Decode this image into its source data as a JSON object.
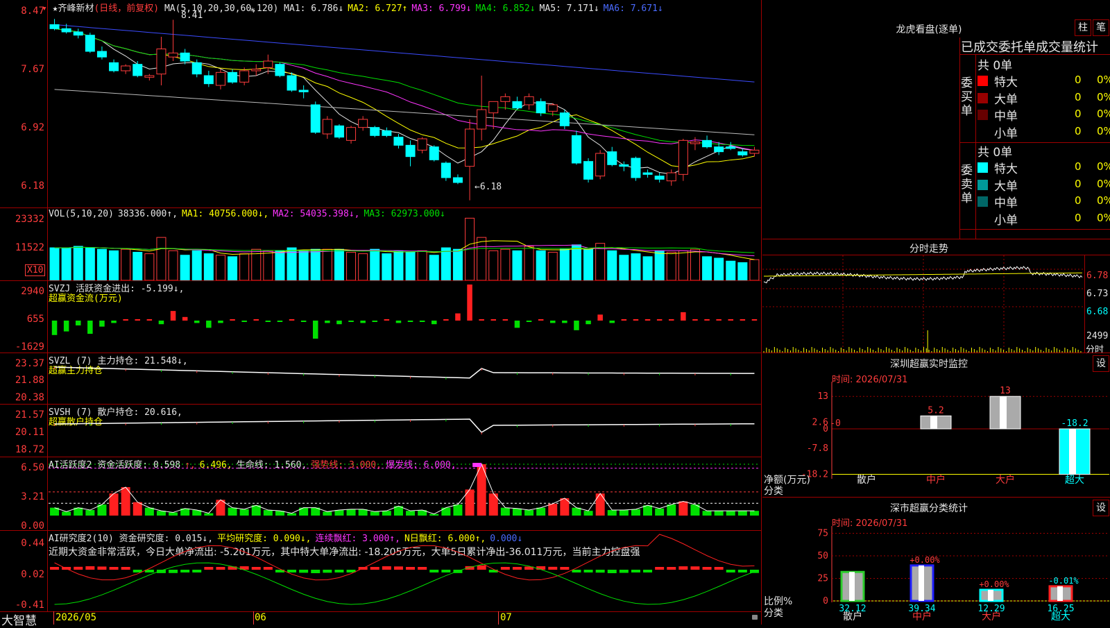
{
  "stock": {
    "marker": "▾",
    "name": "★齐峰新材",
    "period": "(日线，前复权)"
  },
  "ma_line": {
    "prefix": "MA(5,10,20,30,60,120)",
    "items": [
      {
        "label": "MA1: 6.786",
        "arrow": "↓",
        "color": "#e6e6e6"
      },
      {
        "label": "MA2: 6.727",
        "arrow": "↑",
        "color": "#ffff00"
      },
      {
        "label": "MA3: 6.799",
        "arrow": "↓",
        "color": "#ff35ff"
      },
      {
        "label": "MA4: 6.852",
        "arrow": "↓",
        "color": "#00e000"
      },
      {
        "label": "MA5: 7.171",
        "arrow": "↓",
        "color": "#e6e6e6"
      },
      {
        "label": "MA6: 7.671",
        "arrow": "↓",
        "color": "#4a6bff"
      }
    ]
  },
  "price_axis": [
    "8.47",
    "7.67",
    "6.92",
    "6.18"
  ],
  "price_annotations": {
    "high": "8.41",
    "low": "←6.18"
  },
  "vol": {
    "axis": [
      "23332",
      "11522"
    ],
    "unit": "X10",
    "legend": [
      {
        "text": "VOL(5,10,20)",
        "color": "#e6e6e6"
      },
      {
        "text": "38336.000↑,",
        "color": "#e6e6e6"
      },
      {
        "text": "MA1: 40756.000↓,",
        "color": "#ffff00"
      },
      {
        "text": "MA2: 54035.398↓,",
        "color": "#ff35ff"
      },
      {
        "text": "MA3: 62973.000↓",
        "color": "#00e000"
      }
    ]
  },
  "svzj": {
    "axis": [
      "2940",
      "655",
      "-1629"
    ],
    "line1": "SVZJ  活跃资金进出: -5.199↓,",
    "line2": "超赢资金流(万元)"
  },
  "svzl": {
    "axis": [
      "23.37",
      "21.88",
      "20.38"
    ],
    "line1": "SVZL (7) 主力持仓: 21.548↓,",
    "line2": "超赢主力持仓"
  },
  "svsh": {
    "axis": [
      "21.57",
      "20.11",
      "18.72"
    ],
    "line1": "SVSH (7) 散户持仓: 20.616,",
    "line2": "超赢散户持仓"
  },
  "ai_active": {
    "axis": [
      "6.50",
      "3.21",
      "0.00"
    ],
    "legend": [
      {
        "text": "AI活跃度2 资金活跃度: 0.598",
        "color": "#e6e6e6"
      },
      {
        "text": "↑,",
        "color": "#ff3c3c"
      },
      {
        "text": "6.496,",
        "color": "#ffff00"
      },
      {
        "text": "生命线: 1.560,",
        "color": "#e6e6e6"
      },
      {
        "text": "强势线: 3.000,",
        "color": "#ff3c3c"
      },
      {
        "text": "爆发线: 6.000,",
        "color": "#ff35ff"
      }
    ]
  },
  "ai_research": {
    "axis": [
      "0.44",
      "0.02",
      "-0.41"
    ],
    "legend": [
      {
        "text": "AI研究度2(10) 资金研究度: 0.015↓,",
        "color": "#e6e6e6"
      },
      {
        "text": "平均研究度: 0.090↓,",
        "color": "#ffff00"
      },
      {
        "text": "连续飘红: 3.000↑,",
        "color": "#ff35ff"
      },
      {
        "text": "N日飘红: 6.000↑,",
        "color": "#ffff00"
      },
      {
        "text": "0.000↓",
        "color": "#4a6bff"
      }
    ],
    "comment": "近期大资金非常活跃，今日大单净流出: -5.201万元，其中特大单净流出: -18.205万元，大单5日累计净出-36.011万元，当前主力控盘强"
  },
  "bottom_bar": {
    "brand": "大智慧",
    "dates": [
      "2026/05",
      "06",
      "07"
    ]
  },
  "dragon_tiger": {
    "title": "龙虎看盘(逐单)",
    "btn_bar": "柱",
    "btn_pen": "笔",
    "tabs": "已成交委托单成交量统计",
    "buy": {
      "side": "委买单",
      "total": "共 0单",
      "rows": [
        {
          "name": "特大",
          "count": "0",
          "pct": "0%",
          "color": "#ff0000"
        },
        {
          "name": "大单",
          "count": "0",
          "pct": "0%",
          "color": "#990000"
        },
        {
          "name": "中单",
          "count": "0",
          "pct": "0%",
          "color": "#660000"
        },
        {
          "name": "小单",
          "count": "0",
          "pct": "0%",
          "color": "#000000"
        }
      ]
    },
    "sell": {
      "side": "委卖单",
      "total": "共 0单",
      "rows": [
        {
          "name": "特大",
          "count": "0",
          "pct": "0%",
          "color": "#00ffff"
        },
        {
          "name": "大单",
          "count": "0",
          "pct": "0%",
          "color": "#009999"
        },
        {
          "name": "中单",
          "count": "0",
          "pct": "0%",
          "color": "#006666"
        },
        {
          "name": "小单",
          "count": "0",
          "pct": "0%",
          "color": "#000000"
        }
      ]
    }
  },
  "intraday": {
    "title": "分时走势",
    "axis": [
      "6.78",
      "6.73",
      "6.68"
    ],
    "vol_label": "2499",
    "vol_unit": "分时"
  },
  "realtime_monitor": {
    "title": "深圳超赢实时监控",
    "btn": "设",
    "time": "时间: 2026/07/31",
    "axis": [
      "13",
      "2.6",
      "0",
      "-7.8",
      "-18.2"
    ],
    "ylabel": "净额(万元)",
    "xlabel": "分类",
    "categories": [
      "散户",
      "中户",
      "大户",
      "超大"
    ],
    "values": [
      0,
      5.2,
      13,
      -18.2
    ],
    "labels": [
      "-0",
      "5.2",
      "13",
      "-18.2"
    ]
  },
  "class_stats": {
    "title": "深市超赢分类统计",
    "btn": "设",
    "time": "时间: 2026/07/31",
    "axis": [
      "75",
      "50",
      "25",
      "0"
    ],
    "ylabel": "比例%",
    "xlabel": "分类",
    "categories": [
      "散户",
      "中户",
      "大户",
      "超大"
    ],
    "values": [
      32.12,
      39.34,
      12.29,
      16.25
    ],
    "changes": [
      "",
      "+0.00%",
      "+0.00%",
      "-0.01%"
    ]
  },
  "chart_data": [
    {
      "type": "candlestick",
      "title": "齐峰新材 (日线，前复权)",
      "x": [
        "2026/05",
        "06",
        "07"
      ],
      "ylim": [
        6.18,
        8.47
      ],
      "ohlc": [
        [
          8.35,
          8.42,
          8.28,
          8.3
        ],
        [
          8.3,
          8.36,
          8.24,
          8.26
        ],
        [
          8.26,
          8.3,
          8.18,
          8.22
        ],
        [
          8.22,
          8.25,
          8.0,
          8.02
        ],
        [
          8.02,
          8.08,
          7.92,
          7.95
        ],
        [
          7.88,
          7.92,
          7.76,
          7.78
        ],
        [
          7.78,
          7.86,
          7.74,
          7.84
        ],
        [
          7.86,
          7.9,
          7.7,
          7.72
        ],
        [
          7.7,
          7.74,
          7.66,
          7.72
        ],
        [
          7.74,
          8.2,
          7.6,
          8.05
        ],
        [
          7.95,
          8.41,
          7.9,
          8.0
        ],
        [
          8.0,
          8.05,
          7.86,
          7.9
        ],
        [
          7.88,
          7.92,
          7.7,
          7.74
        ],
        [
          7.72,
          7.78,
          7.58,
          7.62
        ],
        [
          7.6,
          7.8,
          7.55,
          7.76
        ],
        [
          7.76,
          7.8,
          7.62,
          7.64
        ],
        [
          7.64,
          7.82,
          7.6,
          7.78
        ],
        [
          7.78,
          7.86,
          7.72,
          7.8
        ],
        [
          7.82,
          7.98,
          7.74,
          7.9
        ],
        [
          7.86,
          7.88,
          7.7,
          7.72
        ],
        [
          7.72,
          7.76,
          7.52,
          7.54
        ],
        [
          7.54,
          7.6,
          7.44,
          7.52
        ],
        [
          7.36,
          7.4,
          7.0,
          7.02
        ],
        [
          7.0,
          7.22,
          6.94,
          7.18
        ],
        [
          7.1,
          7.12,
          6.94,
          6.96
        ],
        [
          6.92,
          7.1,
          6.88,
          7.08
        ],
        [
          7.08,
          7.22,
          7.04,
          7.18
        ],
        [
          7.08,
          7.1,
          6.96,
          6.98
        ],
        [
          7.04,
          7.08,
          6.96,
          6.98
        ],
        [
          6.96,
          7.0,
          6.82,
          6.86
        ],
        [
          6.86,
          6.92,
          6.6,
          6.72
        ],
        [
          6.8,
          6.96,
          6.76,
          6.94
        ],
        [
          6.84,
          6.86,
          6.66,
          6.68
        ],
        [
          6.64,
          6.66,
          6.42,
          6.46
        ],
        [
          6.46,
          6.5,
          6.38,
          6.4
        ],
        [
          6.6,
          7.18,
          6.18,
          7.06
        ],
        [
          7.06,
          7.72,
          6.92,
          7.3
        ],
        [
          7.26,
          7.4,
          7.06,
          7.4
        ],
        [
          7.4,
          7.5,
          7.3,
          7.46
        ],
        [
          7.4,
          7.46,
          7.3,
          7.32
        ],
        [
          7.36,
          7.5,
          7.3,
          7.46
        ],
        [
          7.4,
          7.44,
          7.22,
          7.26
        ],
        [
          7.28,
          7.38,
          7.22,
          7.36
        ],
        [
          7.26,
          7.3,
          7.06,
          7.1
        ],
        [
          6.98,
          7.04,
          6.62,
          6.64
        ],
        [
          6.66,
          6.7,
          6.4,
          6.44
        ],
        [
          6.48,
          6.8,
          6.44,
          6.76
        ],
        [
          6.78,
          6.84,
          6.6,
          6.62
        ],
        [
          6.62,
          6.66,
          6.54,
          6.6
        ],
        [
          6.7,
          6.72,
          6.42,
          6.46
        ],
        [
          6.52,
          6.56,
          6.46,
          6.5
        ],
        [
          6.48,
          6.52,
          6.4,
          6.44
        ],
        [
          6.42,
          6.56,
          6.36,
          6.52
        ],
        [
          6.5,
          6.94,
          6.42,
          6.92
        ],
        [
          6.88,
          6.96,
          6.8,
          6.9
        ],
        [
          6.92,
          6.98,
          6.82,
          6.84
        ],
        [
          6.84,
          6.9,
          6.74,
          6.78
        ],
        [
          6.84,
          6.9,
          6.8,
          6.82
        ],
        [
          6.78,
          6.82,
          6.72,
          6.74
        ],
        [
          6.76,
          6.84,
          6.72,
          6.8
        ]
      ]
    },
    {
      "type": "bar",
      "title": "VOL",
      "values": [
        22,
        22,
        23,
        22,
        21,
        20,
        21,
        19,
        18,
        29,
        20,
        17,
        20,
        18,
        17,
        16,
        18,
        21,
        20,
        20,
        22,
        20,
        21,
        21,
        21,
        19,
        18,
        21,
        18,
        20,
        19,
        20,
        17,
        22,
        21,
        42,
        29,
        20,
        21,
        20,
        23,
        20,
        19,
        21,
        24,
        21,
        25,
        20,
        17,
        18,
        16,
        20,
        19,
        20,
        21,
        16,
        15,
        13,
        12,
        14
      ]
    },
    {
      "type": "bar",
      "title": "SVZJ",
      "values": [
        -1200,
        -900,
        -400,
        -1100,
        -500,
        -200,
        0,
        100,
        100,
        -300,
        800,
        300,
        -200,
        -600,
        -200,
        0,
        -100,
        0,
        -100,
        -100,
        0,
        -100,
        -1500,
        -200,
        -300,
        -100,
        -200,
        -100,
        0,
        -200,
        -100,
        -100,
        -300,
        100,
        600,
        3000,
        0,
        0,
        0,
        -600,
        -100,
        0,
        -200,
        -200,
        -800,
        -300,
        500,
        -200,
        0,
        0,
        0,
        0,
        100,
        700,
        0,
        0,
        0,
        100,
        0,
        0
      ]
    },
    {
      "type": "bar",
      "title": "AI活跃度2",
      "values": [
        1.0,
        0.5,
        1.0,
        0.7,
        1.4,
        2.8,
        3.6,
        1.7,
        1.0,
        0.6,
        0.4,
        0.9,
        0.7,
        0.3,
        2.0,
        1.0,
        0.8,
        1.3,
        0.7,
        0.6,
        0.3,
        1.0,
        1.0,
        0.5,
        0.7,
        0.8,
        0.8,
        0.5,
        0.6,
        1.2,
        0.6,
        0.7,
        0.2,
        1.0,
        1.4,
        3.3,
        6.5,
        2.8,
        1.0,
        0.9,
        0.7,
        1.0,
        1.5,
        2.2,
        1.0,
        0.6,
        2.8,
        0.7,
        0.7,
        0.8,
        1.3,
        0.9,
        1.4,
        1.8,
        1.4,
        0.6,
        0.6,
        0.6,
        0.6,
        0.6
      ]
    }
  ]
}
